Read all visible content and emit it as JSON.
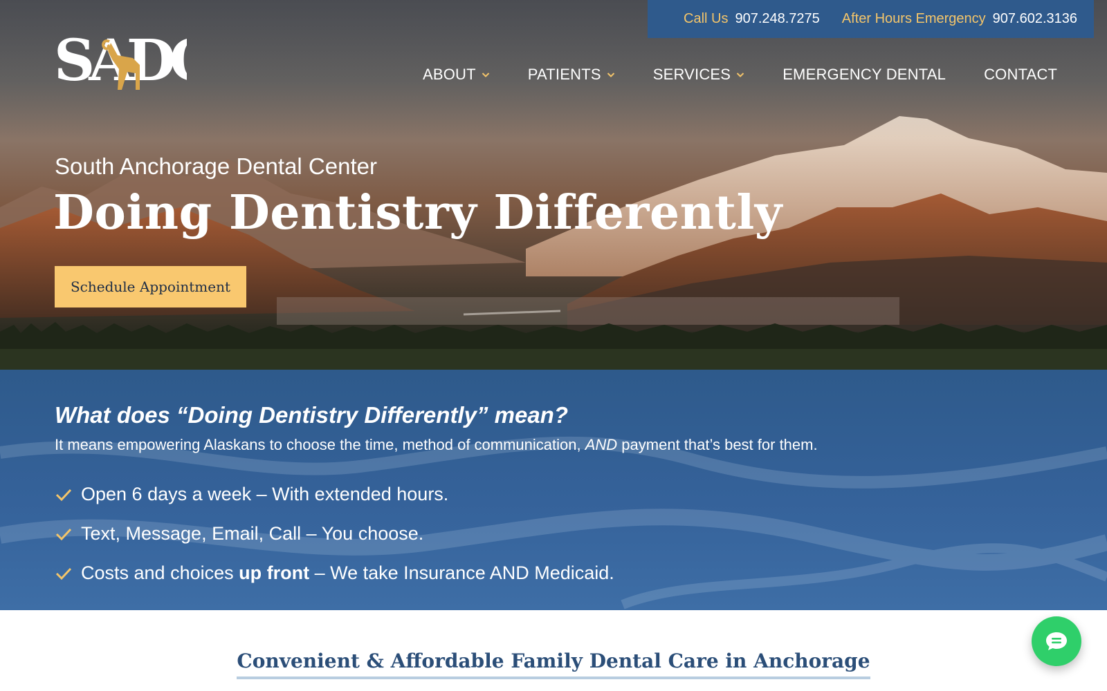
{
  "topbar": {
    "call_label": "Call Us",
    "call_number": "907.248.7275",
    "emergency_label": "After Hours Emergency",
    "emergency_number": "907.602.3136"
  },
  "logo": {
    "text": "SADC",
    "icon": "ram-icon"
  },
  "nav": {
    "about": "ABOUT",
    "patients": "PATIENTS",
    "services": "SERVICES",
    "emergency": "EMERGENCY DENTAL",
    "contact": "CONTACT"
  },
  "hero": {
    "subtitle": "South Anchorage Dental Center",
    "title": "Doing Dentistry Differently",
    "cta": "Schedule Appointment"
  },
  "band": {
    "heading": "What does “Doing Dentistry Differently” mean?",
    "lead_start": "It means empowering Alaskans to choose the time,  method of communication, ",
    "lead_em": "AND",
    "lead_end": " payment that’s best for them.",
    "items": [
      {
        "text": "Open 6 days a week – With extended hours."
      },
      {
        "text": "Text, Message, Email, Call – You choose."
      },
      {
        "text_start": "Costs and choices ",
        "text_bold": "up front",
        "text_end": " – We take Insurance AND Medicaid."
      }
    ]
  },
  "intro": {
    "title": "Convenient & Affordable Family Dental Care in Anchorage"
  },
  "chat": {
    "icon": "chat-icon"
  },
  "colors": {
    "brand_blue": "#2f5a8c",
    "accent_gold": "#f9c86f",
    "chat_green": "#2fcf6a"
  }
}
